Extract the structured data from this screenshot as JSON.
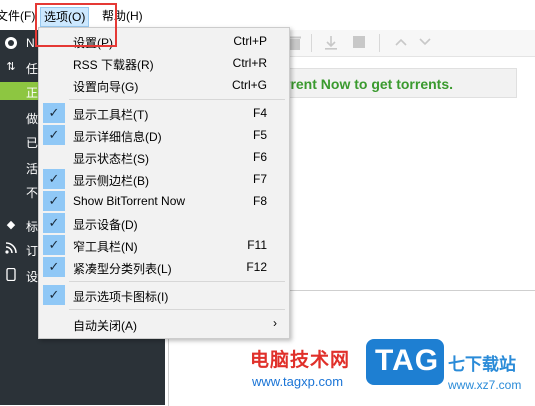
{
  "menubar": {
    "file_label": "文件(F)",
    "options_label": "选项(O)",
    "help_label": "帮助(H)"
  },
  "sidebar": {
    "items": [
      {
        "icon": "bittorrent-logo-icon",
        "text": "N"
      },
      {
        "icon": "transfer-arrows-icon",
        "text": "任"
      },
      {
        "icon": "",
        "text": "正"
      },
      {
        "icon": "",
        "text": "做"
      },
      {
        "icon": "",
        "text": "已"
      },
      {
        "icon": "",
        "text": "活"
      },
      {
        "icon": "",
        "text": "不"
      },
      {
        "icon": "tag-icon",
        "text": "标"
      },
      {
        "icon": "rss-icon",
        "text": "订"
      },
      {
        "icon": "device-icon",
        "text": "设"
      }
    ]
  },
  "toolbar": {
    "icons": [
      "delete-icon",
      "download-icon",
      "stop-icon",
      "up-icon",
      "down-icon"
    ]
  },
  "banner": {
    "text": "rrent Now to get torrents."
  },
  "dropdown": {
    "items": [
      {
        "label": "设置(P)",
        "shortcut": "Ctrl+P",
        "checked": false
      },
      {
        "label": "RSS 下载器(R)",
        "shortcut": "Ctrl+R",
        "checked": false
      },
      {
        "label": "设置向导(G)",
        "shortcut": "Ctrl+G",
        "checked": false
      },
      {
        "label": "显示工具栏(T)",
        "shortcut": "F4",
        "checked": true
      },
      {
        "label": "显示详细信息(D)",
        "shortcut": "F5",
        "checked": true
      },
      {
        "label": "显示状态栏(S)",
        "shortcut": "F6",
        "checked": false
      },
      {
        "label": "显示侧边栏(B)",
        "shortcut": "F7",
        "checked": true
      },
      {
        "label": "Show BitTorrent Now",
        "shortcut": "F8",
        "checked": true
      },
      {
        "label": "显示设备(D)",
        "shortcut": "",
        "checked": true
      },
      {
        "label": "窄工具栏(N)",
        "shortcut": "F11",
        "checked": true
      },
      {
        "label": "紧凑型分类列表(L)",
        "shortcut": "F12",
        "checked": true
      },
      {
        "label": "显示选项卡图标(I)",
        "shortcut": "",
        "checked": true
      },
      {
        "label": "自动关闭(A)",
        "shortcut": "",
        "checked": false,
        "submenu": true
      }
    ]
  },
  "watermark": {
    "text": "电脑技术网",
    "url": "www.tagxp.com",
    "logo": "TAG",
    "site": "七下载站",
    "site_url": "www.xz7.com"
  },
  "colors": {
    "sidebar_bg": "#2b3238",
    "sidebar_active": "#8dc641",
    "check_bg": "#90c8f6",
    "banner_text": "#3a9a2e",
    "highlight_border": "#e53935"
  }
}
